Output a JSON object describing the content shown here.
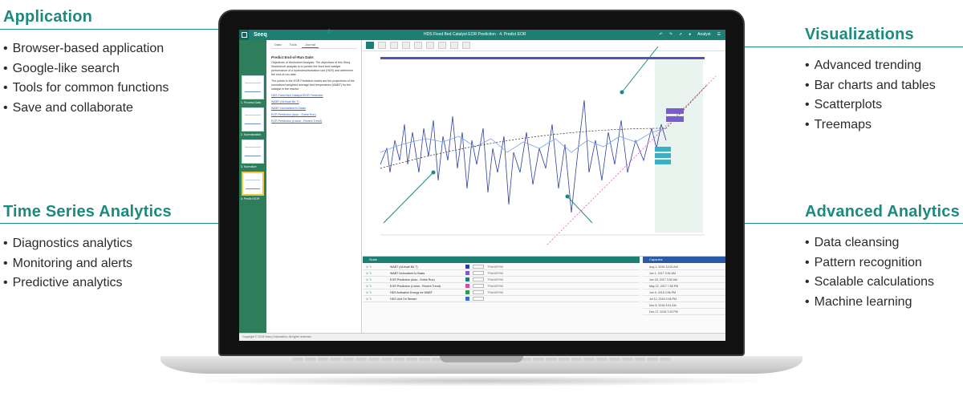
{
  "panels": {
    "application": {
      "title": "Application",
      "items": [
        "Browser-based application",
        "Google-like search",
        "Tools for common functions",
        "Save and collaborate"
      ]
    },
    "time_series": {
      "title": "Time Series Analytics",
      "items": [
        "Diagnostics analytics",
        "Monitoring and alerts",
        "Predictive analytics"
      ]
    },
    "visualizations": {
      "title": "Visualizations",
      "items": [
        "Advanced trending",
        "Bar charts and tables",
        "Scatterplots",
        "Treemaps"
      ]
    },
    "advanced": {
      "title": "Advanced Analytics",
      "items": [
        "Data cleansing",
        "Pattern recognition",
        "Scalable calculations",
        "Machine learning"
      ]
    }
  },
  "app": {
    "logo": "Seeq",
    "status": "",
    "window_title": "HDS Fixed Bed Catalyst EOR Prediction · 4. Predict EOR",
    "user": "Analyst",
    "tabs": [
      "Data",
      "Tools",
      "Journal"
    ],
    "journal_heading": "Predict End-of-Run Date:",
    "journal_paras": [
      "Objectives of Worksheet Analysis: The objectives of this Seeq Workbench analysis is to predict the fixed bed catalyst performance of a hydrodesulfurization unit (HDS) and determine the end-of-run date.",
      "The points in the EOR Prediction charts are the projections of the normalized weighted average bed temperature (WABT) for the catalyst in the reactor."
    ],
    "journal_links": [
      "HDS Fixed Bed Catalyst EOR Prediction",
      "WABT (All Avail Bd T)",
      "WABT Normalized to Basis",
      "EOR Prediction (Auto - Entire Run)",
      "EOR Prediction (Linear - Recent Trend)"
    ],
    "thumbs": [
      "1. Process Data",
      "2. Normalization",
      "3. Normalize",
      "4. Predict EOR"
    ],
    "scale_title": "Scale",
    "capsules_title": "Capsules",
    "table_rows": [
      {
        "name": "WABT (All Avail Bd T)",
        "color": "#2a3f9e",
        "axis": "TRANSFRM"
      },
      {
        "name": "WABT Normalized to Basis",
        "color": "#7a5ccf",
        "axis": "TRANSFRM"
      },
      {
        "name": "EOR Prediction (Auto - Entire Run)",
        "color": "#1d7f73",
        "axis": "TRANSFRM"
      },
      {
        "name": "EOR Prediction (Linear - Recent Trend)",
        "color": "#d14f9e",
        "axis": "TRANSFRM"
      },
      {
        "name": "HDS Activation Energy for WABT",
        "color": "#2c9c4e",
        "axis": "TRANSFRM"
      },
      {
        "name": "HDS Unit On Stream",
        "color": "#3a6ad6",
        "axis": ""
      }
    ],
    "capsules": [
      "Aug 1, 2016 12:00 AM",
      "Jan 1, 2017 9:52 AM",
      "Jan 18, 2017 3:52 AM",
      "May 12, 2017 7:55 PM",
      "Jun 9, 2018 3:56 PM",
      "Jul 12, 2018 2:08 PM",
      "Nov 5, 2018 9:51 AM",
      "Dec 17, 2018 7:43 PM"
    ],
    "statusbar": "Copyright © 2018 Seeq Corporation. All rights reserved."
  },
  "colors": {
    "accent": "#1d8a7e",
    "app_bar": "#1d7f73",
    "series_primary": "#2a3f9e",
    "series_secondary": "#7fa3e6",
    "prediction": "#d14f9e"
  }
}
